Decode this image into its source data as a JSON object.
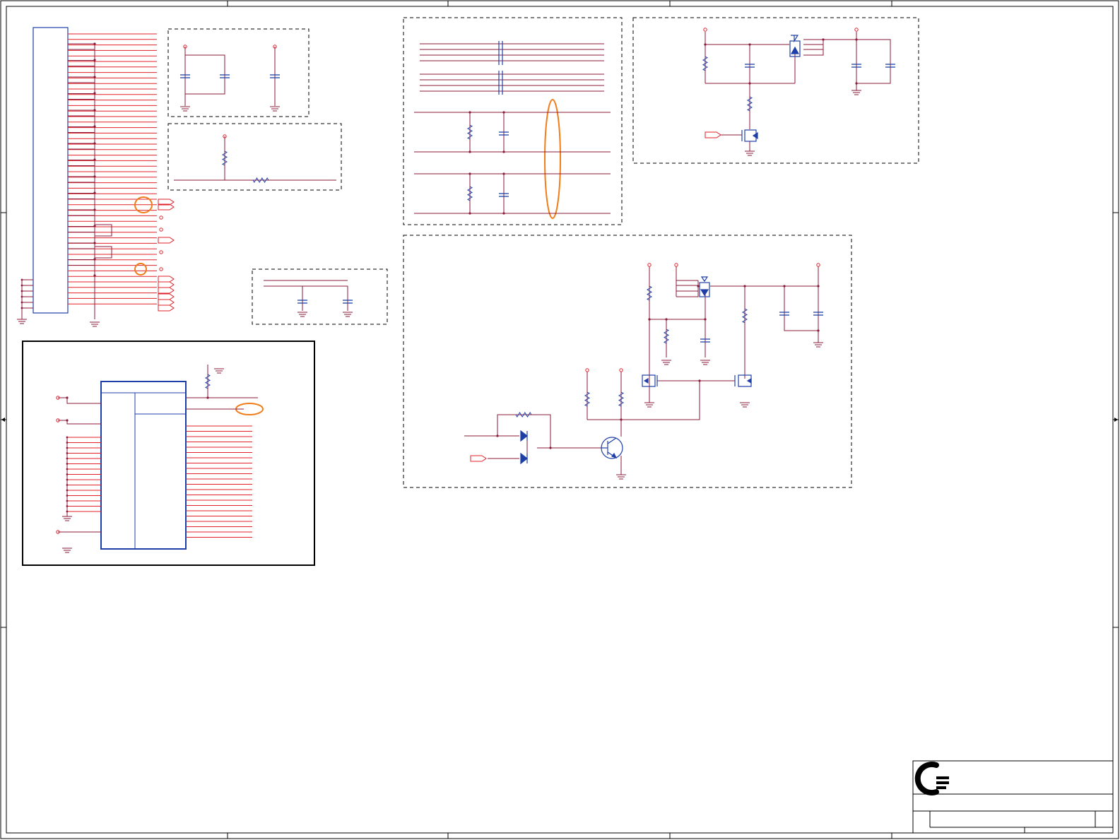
{
  "sheet": {
    "title_block": {
      "logo": "logo-mark",
      "rows": [
        "",
        "",
        ""
      ]
    }
  },
  "colors": {
    "wire": "#8b1a3a",
    "pin": "#e0202a",
    "component": "#1f3fa8",
    "highlight": "#f07d1a",
    "border": "#000000"
  },
  "icons": [
    "resistor-icon",
    "capacitor-icon",
    "ground-icon",
    "power-port-icon",
    "mosfet-icon",
    "diode-icon",
    "bjt-transistor-icon",
    "off-page-connector-icon",
    "logo-mark"
  ]
}
